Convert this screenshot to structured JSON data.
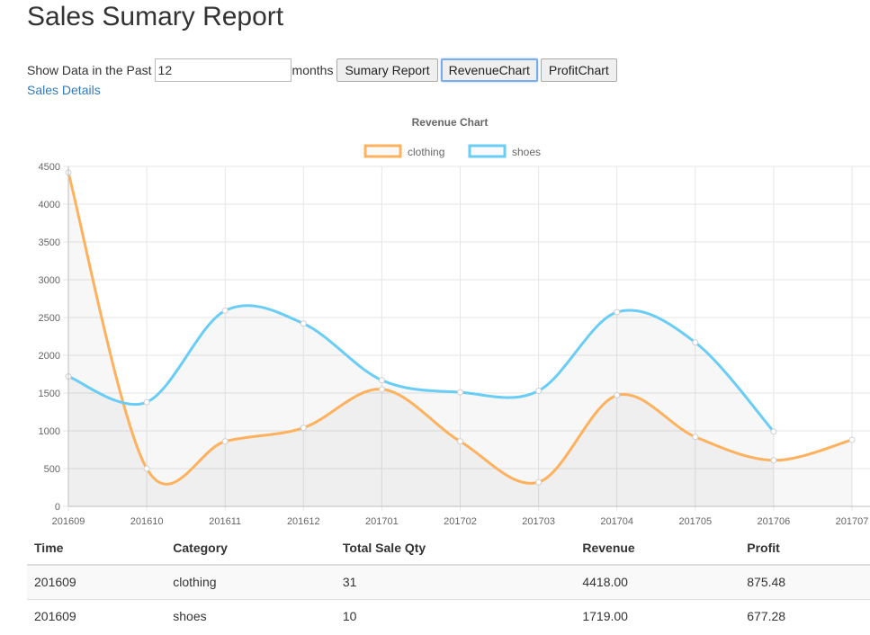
{
  "page": {
    "title": "Sales Sumary Report"
  },
  "controls": {
    "prefix_label": "Show Data in the Past",
    "months_value": "12",
    "suffix_label": "months",
    "buttons": [
      "Sumary Report",
      "RevenueChart",
      "ProfitChart"
    ],
    "active_button": "RevenueChart"
  },
  "sales_details_link": "Sales Details",
  "colors": {
    "clothing": "#ffb15e",
    "shoes": "#69cdf6",
    "link": "#337ab7"
  },
  "chart_data": {
    "type": "line",
    "title": "Revenue Chart",
    "categories": [
      "201609",
      "201610",
      "201611",
      "201612",
      "201701",
      "201702",
      "201703",
      "201704",
      "201705",
      "201706",
      "201707"
    ],
    "series": [
      {
        "name": "clothing",
        "values": [
          4418,
          500,
          860,
          1040,
          1550,
          860,
          320,
          1470,
          920,
          610,
          880
        ]
      },
      {
        "name": "shoes",
        "values": [
          1719,
          1380,
          2590,
          2420,
          1670,
          1510,
          1530,
          2570,
          2170,
          990,
          null
        ]
      }
    ],
    "y_ticks": [
      0,
      500,
      1000,
      1500,
      2000,
      2500,
      3000,
      3500,
      4000,
      4500
    ],
    "ylim": [
      0,
      4500
    ],
    "legend_position": "top-center",
    "grid": true,
    "area_fill": true
  },
  "table": {
    "headers": [
      "Time",
      "Category",
      "Total Sale Qty",
      "Revenue",
      "Profit"
    ],
    "rows": [
      [
        "201609",
        "clothing",
        "31",
        "4418.00",
        "875.48"
      ],
      [
        "201609",
        "shoes",
        "10",
        "1719.00",
        "677.28"
      ]
    ]
  }
}
